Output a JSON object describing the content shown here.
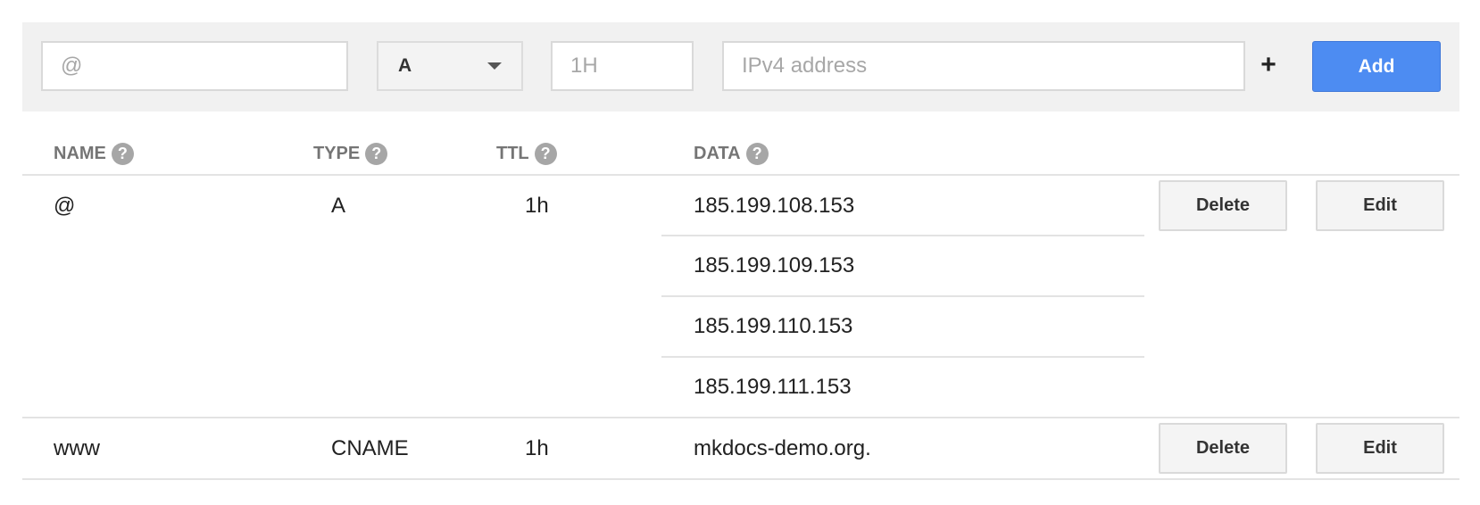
{
  "form": {
    "name_placeholder": "@",
    "type_value": "A",
    "ttl_placeholder": "1H",
    "data_placeholder": "IPv4 address",
    "add_more_symbol": "+",
    "add_label": "Add"
  },
  "table": {
    "headers": [
      "NAME",
      "TYPE",
      "TTL",
      "DATA"
    ],
    "help_symbol": "?",
    "records": [
      {
        "name": "@",
        "type": "A",
        "ttl": "1h",
        "data": [
          "185.199.108.153",
          "185.199.109.153",
          "185.199.110.153",
          "185.199.111.153"
        ],
        "delete_label": "Delete",
        "edit_label": "Edit"
      },
      {
        "name": "www",
        "type": "CNAME",
        "ttl": "1h",
        "data": [
          "mkdocs-demo.org."
        ],
        "delete_label": "Delete",
        "edit_label": "Edit"
      }
    ]
  },
  "colors": {
    "toolbar_bg": "#f1f1f1",
    "add_button": "#4d8cf2",
    "header_text": "#757575",
    "help_icon": "#a6a6a6",
    "divider": "#e3e3e3"
  },
  "icons": {
    "type_dropdown": "caret-down-icon",
    "add_more": "plus-icon",
    "header_help": "help-icon"
  }
}
